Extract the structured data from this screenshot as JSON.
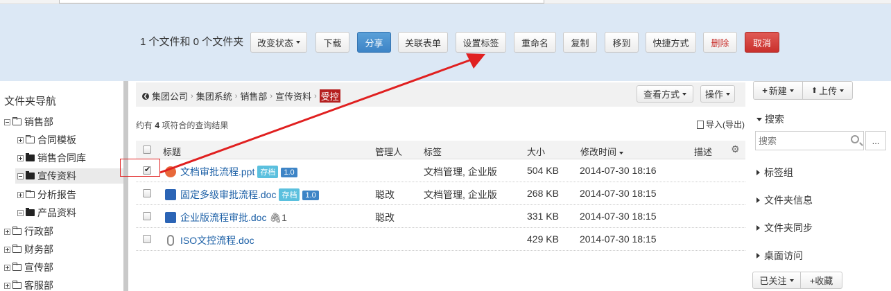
{
  "action_bar": {
    "selection_text": "1 个文件和 0 个文件夹",
    "buttons": {
      "change_status": "改变状态",
      "download": "下载",
      "share": "分享",
      "link_form": "关联表单",
      "set_tags": "设置标签",
      "rename": "重命名",
      "copy": "复制",
      "move": "移到",
      "shortcut": "快捷方式",
      "delete": "删除",
      "cancel": "取消"
    }
  },
  "left_nav": {
    "title": "文件夹导航",
    "items": [
      {
        "label": "销售部"
      },
      {
        "label": "合同模板"
      },
      {
        "label": "销售合同库"
      },
      {
        "label": "宣传资料"
      },
      {
        "label": "分析报告"
      },
      {
        "label": "产品资料"
      },
      {
        "label": "行政部"
      },
      {
        "label": "财务部"
      },
      {
        "label": "宣传部"
      },
      {
        "label": "客服部"
      }
    ]
  },
  "breadcrumb": {
    "items": [
      "集团公司",
      "集团系统",
      "销售部",
      "宣传资料"
    ],
    "current": "受控",
    "view_mode": "查看方式",
    "operations": "操作"
  },
  "results": {
    "prefix": "约有",
    "count": "4",
    "suffix": "项符合的查询结果",
    "import_label": "导入(导出)"
  },
  "table": {
    "headers": {
      "title": "标题",
      "manager": "管理人",
      "tags": "标签",
      "size": "大小",
      "modified": "修改时间",
      "desc": "描述"
    },
    "rows": [
      {
        "name": "文档审批流程.ppt",
        "badge1": "存档",
        "badge2": "1.0",
        "manager": "",
        "tags": "文档管理, 企业版",
        "size": "504 KB",
        "modified": "2014-07-30 18:16"
      },
      {
        "name": "固定多级审批流程.doc",
        "badge1": "存档",
        "badge2": "1.0",
        "manager": "聪改",
        "tags": "文档管理, 企业版",
        "size": "268 KB",
        "modified": "2014-07-30 18:15"
      },
      {
        "name": "企业版流程审批.doc",
        "attach": "1",
        "manager": "聪改",
        "tags": "",
        "size": "331 KB",
        "modified": "2014-07-30 18:15"
      },
      {
        "name": "ISO文控流程.doc",
        "manager": "",
        "tags": "",
        "size": "429 KB",
        "modified": "2014-07-30 18:15"
      }
    ]
  },
  "right_panel": {
    "new_label": "新建",
    "upload_label": "上传",
    "search_title": "搜索",
    "search_placeholder": "搜索",
    "more": "...",
    "sections": [
      "标签组",
      "文件夹信息",
      "文件夹同步",
      "桌面访问"
    ],
    "follow_label": "已关注",
    "favorite_label": "+收藏"
  },
  "colors": {
    "action_bar_bg": "#dce8f5",
    "primary": "#3d84c6",
    "danger": "#c9302c",
    "badge_store": "#5bc0de",
    "arrow": "#e02020"
  }
}
